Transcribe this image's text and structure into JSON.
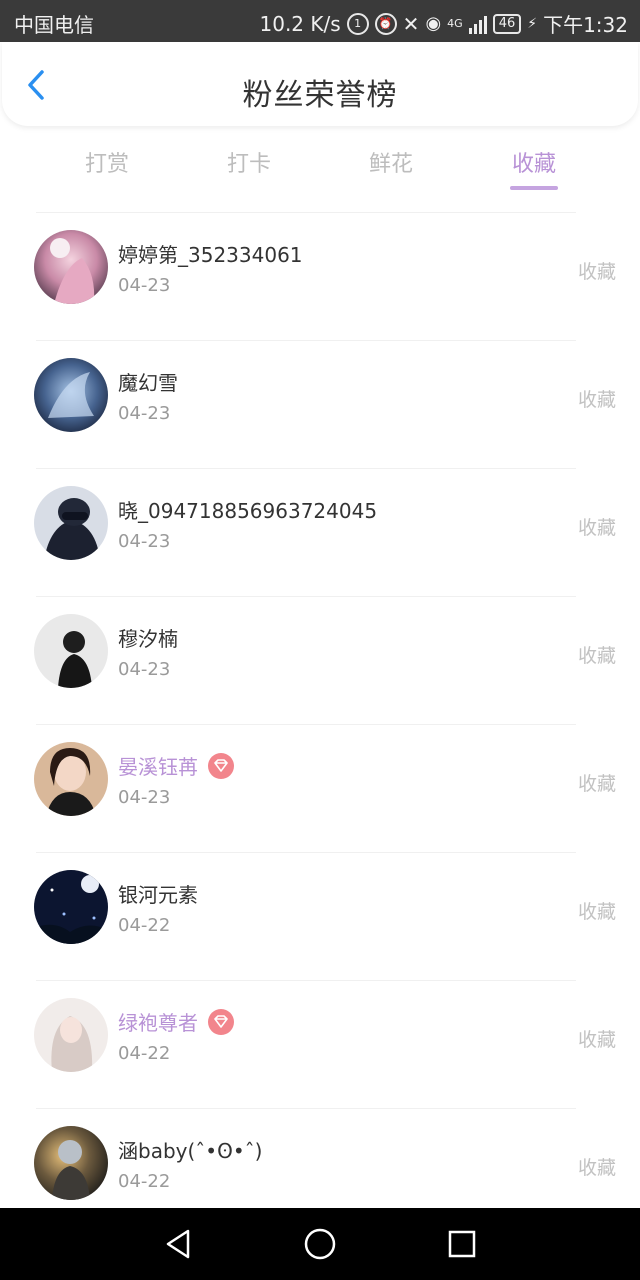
{
  "status_bar": {
    "carrier": "中国电信",
    "speed": "10.2 K/s",
    "network": "4G",
    "battery": "46",
    "time": "下午1:32"
  },
  "header": {
    "title": "粉丝荣誉榜",
    "back_icon": "chevron-left-icon"
  },
  "tabs": [
    {
      "label": "打赏",
      "active": false
    },
    {
      "label": "打卡",
      "active": false
    },
    {
      "label": "鲜花",
      "active": false
    },
    {
      "label": "收藏",
      "active": true
    }
  ],
  "colors": {
    "accent": "#b892d6",
    "vip_badge": "#f2858c",
    "muted": "#c2c2c2"
  },
  "fans": [
    {
      "name": "婷婷第_352334061",
      "date": "04-23",
      "action": "收藏",
      "vip": false
    },
    {
      "name": "魔幻雪",
      "date": "04-23",
      "action": "收藏",
      "vip": false
    },
    {
      "name": "晓_094718856963724045",
      "date": "04-23",
      "action": "收藏",
      "vip": false
    },
    {
      "name": "穆汐楠",
      "date": "04-23",
      "action": "收藏",
      "vip": false
    },
    {
      "name": "晏溪钰苒",
      "date": "04-23",
      "action": "收藏",
      "vip": true
    },
    {
      "name": "银河元素",
      "date": "04-22",
      "action": "收藏",
      "vip": false
    },
    {
      "name": "绿袍尊者",
      "date": "04-22",
      "action": "收藏",
      "vip": true
    },
    {
      "name": "涵baby(ˆ•ʘ•ˆ)",
      "date": "04-22",
      "action": "收藏",
      "vip": false
    }
  ]
}
